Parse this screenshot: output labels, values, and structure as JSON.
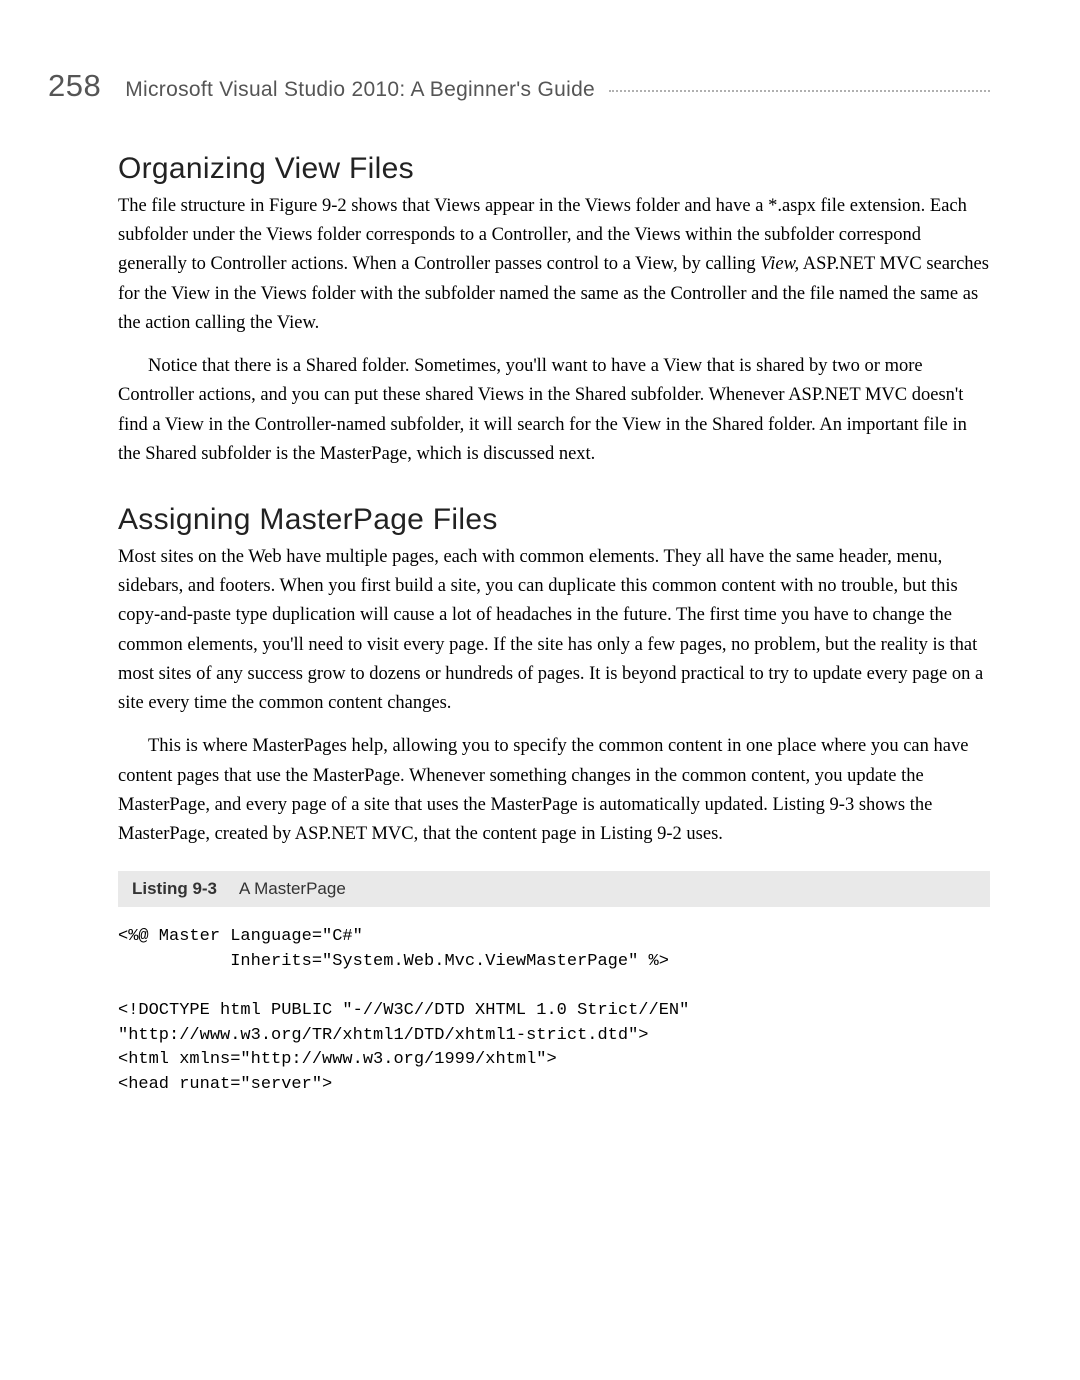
{
  "header": {
    "page_number": "258",
    "running_title": "Microsoft Visual Studio 2010: A Beginner's Guide"
  },
  "section1": {
    "heading": "Organizing View Files",
    "p1a": "The file structure in Figure 9-2 shows that Views appear in the Views folder and have a *.aspx file extension. Each subfolder under the Views folder corresponds to a Controller, and the Views within the subfolder correspond generally to Controller actions. When a Controller passes control to a View, by calling ",
    "p1_italic": "View,",
    "p1b": " ASP.NET MVC searches for the View in the Views folder with the subfolder named the same as the Controller and the file named the same as the action calling the View.",
    "p2": "Notice that there is a Shared folder. Sometimes, you'll want to have a View that is shared by two or more Controller actions, and you can put these shared Views in the Shared subfolder. Whenever ASP.NET MVC doesn't find a View in the Controller-named subfolder, it will search for the View in the Shared folder. An important file in the Shared subfolder is the MasterPage, which is discussed next."
  },
  "section2": {
    "heading": "Assigning MasterPage Files",
    "p1": "Most sites on the Web have multiple pages, each with common elements. They all have the same header, menu, sidebars, and footers. When you first build a site, you can duplicate this common content with no trouble, but this copy-and-paste type duplication will cause a lot of headaches in the future. The first time you have to change the common elements, you'll need to visit every page. If the site has only a few pages, no problem, but the reality is that most sites of any success grow to dozens or hundreds of pages. It is beyond practical to try to update every page on a site every time the common content changes.",
    "p2": "This is where MasterPages help, allowing you to specify the common content in one place where you can have content pages that use the MasterPage. Whenever something changes in the common content, you update the MasterPage, and every page of a site that uses the MasterPage is automatically updated. Listing 9-3 shows the MasterPage, created by ASP.NET MVC, that the content page in Listing 9-2 uses."
  },
  "listing": {
    "label": "Listing 9-3",
    "title": "A MasterPage",
    "code": "<%@ Master Language=\"C#\"\n           Inherits=\"System.Web.Mvc.ViewMasterPage\" %>\n\n<!DOCTYPE html PUBLIC \"-//W3C//DTD XHTML 1.0 Strict//EN\"\n\"http://www.w3.org/TR/xhtml1/DTD/xhtml1-strict.dtd\">\n<html xmlns=\"http://www.w3.org/1999/xhtml\">\n<head runat=\"server\">"
  }
}
